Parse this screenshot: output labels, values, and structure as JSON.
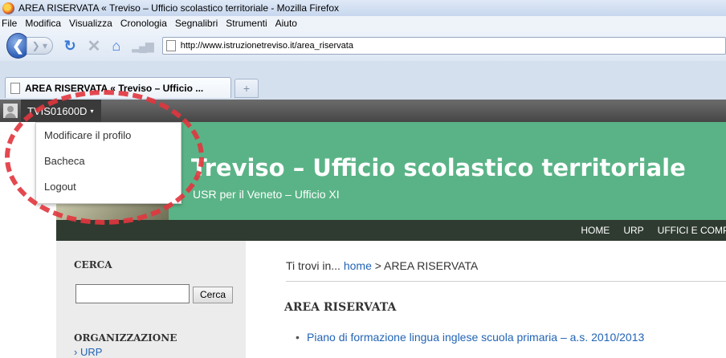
{
  "browser": {
    "window_title": "AREA RISERVATA « Treviso – Ufficio scolastico territoriale - Mozilla Firefox",
    "menu": [
      {
        "label": "File"
      },
      {
        "label": "Modifica"
      },
      {
        "label": "Visualizza"
      },
      {
        "label": "Cronologia"
      },
      {
        "label": "Segnalibri"
      },
      {
        "label": "Strumenti"
      },
      {
        "label": "Aiuto"
      }
    ],
    "url": "http://www.istruzionetreviso.it/area_riservata",
    "tab_title": "AREA RISERVATA « Treviso – Ufficio ...",
    "new_tab": "+"
  },
  "adminbar": {
    "username": "TVIS01600D",
    "caret": "▾",
    "dropdown": [
      {
        "label": "Modificare il profilo"
      },
      {
        "label": "Bacheca"
      },
      {
        "label": "Logout"
      }
    ]
  },
  "site": {
    "title": "Treviso – Ufficio scolastico territoriale",
    "description": "USR per il Veneto – Ufficio XI",
    "nav": [
      "HOME",
      "URP",
      "UFFICI E COMPE"
    ]
  },
  "sidebar": {
    "search_heading": "CERCA",
    "search_value": "",
    "search_button": "Cerca",
    "org_heading": "ORGANIZZAZIONE",
    "org_link": "› URP"
  },
  "main": {
    "breadcrumb_prefix": "Ti trovi in...",
    "breadcrumb_home": "home",
    "breadcrumb_sep": " > ",
    "breadcrumb_current": "AREA RISERVATA",
    "page_heading": "AREA RISERVATA",
    "items": [
      {
        "label": "Piano di formazione lingua inglese scuola primaria – a.s. 2010/2013"
      }
    ]
  },
  "colors": {
    "header_green": "#5ab386",
    "annotation": "#e2363e",
    "link": "#2264b5"
  }
}
